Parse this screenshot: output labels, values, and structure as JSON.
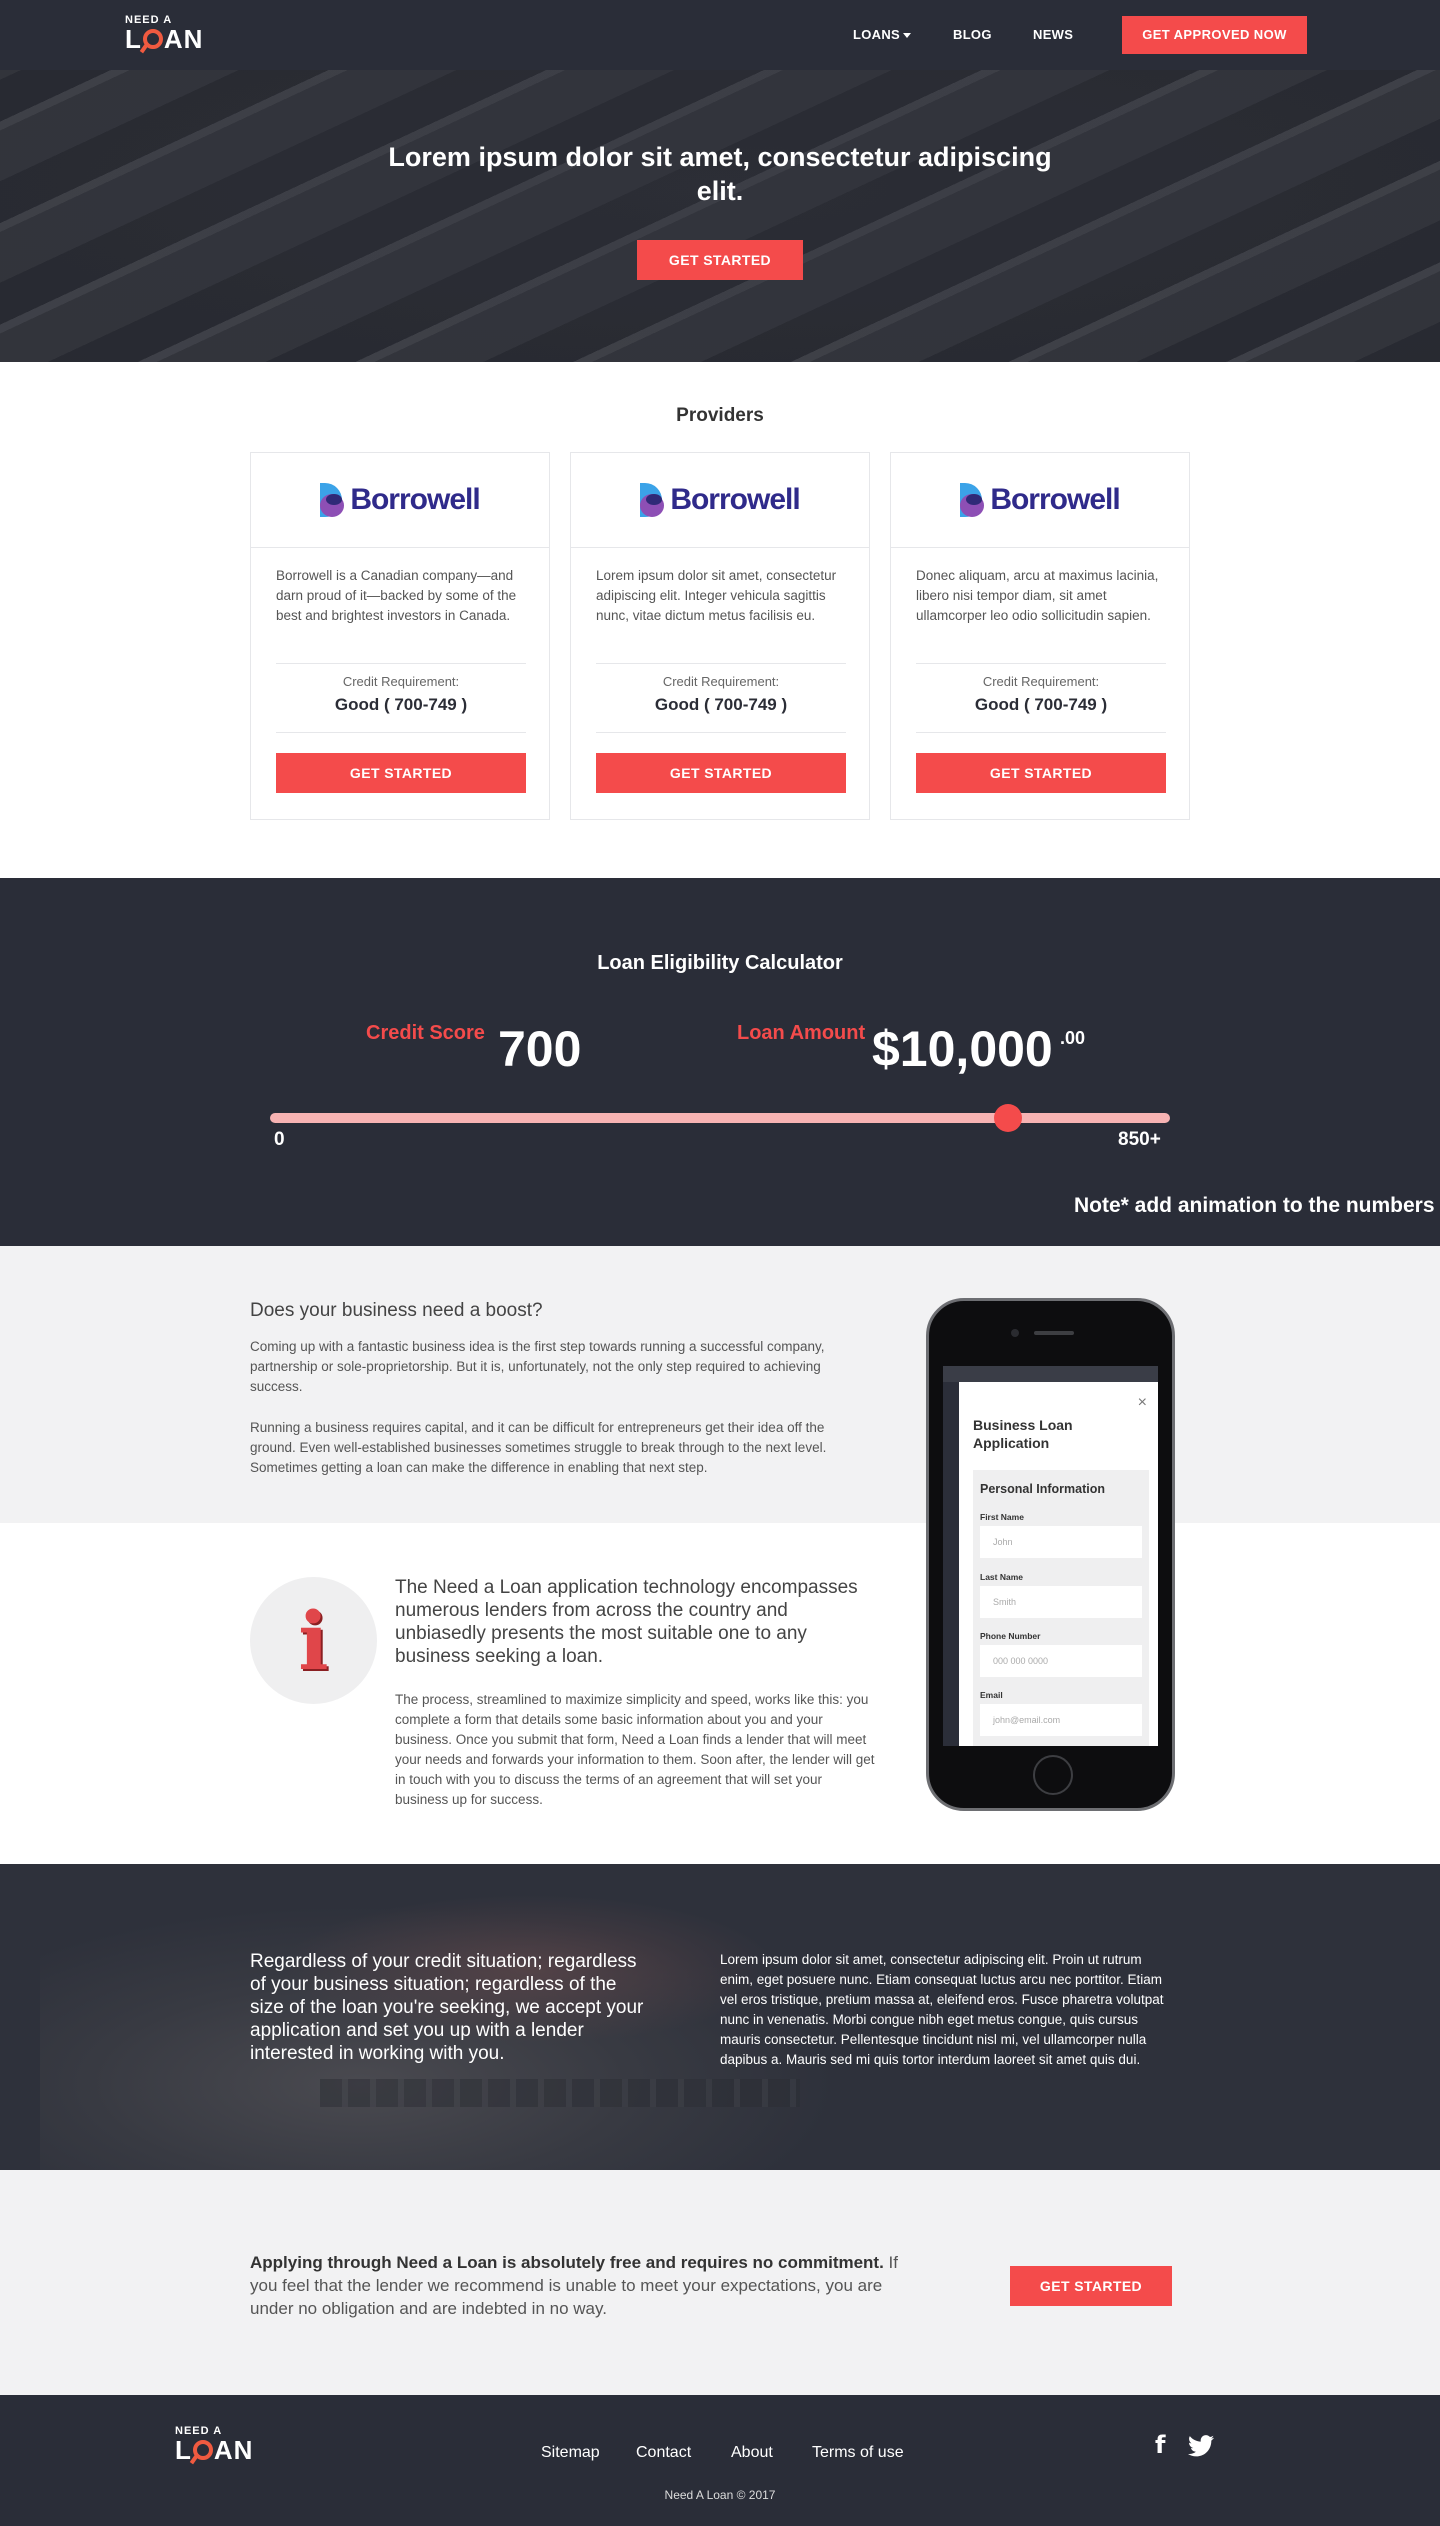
{
  "header": {
    "logo_small": "NEED A",
    "logo_l": "L",
    "logo_an": "AN",
    "nav": {
      "loans": "LOANS",
      "blog": "BLOG",
      "news": "NEWS"
    },
    "cta": "GET APPROVED NOW"
  },
  "hero": {
    "title": "Lorem ipsum dolor sit amet, consectetur adipiscing elit.",
    "cta": "GET STARTED"
  },
  "providers": {
    "title": "Providers",
    "cards": [
      {
        "brand": "Borrowell",
        "description": "Borrowell is a Canadian company—and darn proud of it—backed by some of the best and brightest investors in Canada.",
        "req_label": "Credit Requirement:",
        "req_value": "Good ( 700-749 )",
        "cta": "GET STARTED"
      },
      {
        "brand": "Borrowell",
        "description": "Lorem ipsum dolor sit amet, consectetur adipiscing elit. Integer vehicula sagittis nunc, vitae dictum metus facilisis eu.",
        "req_label": "Credit Requirement:",
        "req_value": "Good ( 700-749 )",
        "cta": "GET STARTED"
      },
      {
        "brand": "Borrowell",
        "description": "Donec aliquam, arcu at maximus lacinia, libero nisi tempor diam, sit amet ullamcorper leo odio sollicitudin sapien.",
        "req_label": "Credit Requirement:",
        "req_value": "Good ( 700-749 )",
        "cta": "GET STARTED"
      }
    ]
  },
  "calculator": {
    "title": "Loan Eligibility Calculator",
    "credit_label": "Credit Score",
    "credit_value": "700",
    "loan_label": "Loan Amount",
    "loan_value": "$10,000",
    "loan_cents": ".00",
    "slider_min": "0",
    "slider_max": "850+",
    "slider_fraction": 0.82,
    "note": "Note* add animation to the numbers"
  },
  "boost": {
    "title": "Does your business need a boost?",
    "p1": "Coming up with a fantastic business idea is the first step towards running a successful company, partnership or sole-proprietorship. But it is, unfortunately, not the only step required to achieving success.",
    "p2": "Running a business requires capital, and it can be difficult for entrepreneurs get their idea off the ground. Even well-established businesses sometimes struggle to break through to the next level. Sometimes getting a loan can make the difference in enabling that next step."
  },
  "info": {
    "icon_glyph": "i",
    "title": "The Need a Loan application technology encompasses numerous lenders from across the country and unbiasedly presents the most suitable one to any business seeking a loan.",
    "body": "The process, streamlined to maximize simplicity and speed, works like this: you complete a form that details some basic information about you and your business. Once you submit that form, Need a Loan finds a lender that will meet your needs and forwards your information to them. Soon after, the lender will get in touch with you to discuss the terms of an agreement that will set your business up for success."
  },
  "phone_form": {
    "close": "×",
    "title": "Business Loan Application",
    "section": "Personal Information",
    "fields": [
      {
        "label": "First Name",
        "placeholder": "John"
      },
      {
        "label": "Last Name",
        "placeholder": "Smith"
      },
      {
        "label": "Phone Number",
        "placeholder": "000 000 0000"
      },
      {
        "label": "Email",
        "placeholder": "john@email.com"
      }
    ]
  },
  "quote": {
    "left": "Regardless of your credit situation; regardless of your business situation; regardless of the size of the loan you're seeking, we accept your application and set you up with a lender interested in working with you.",
    "right": "Lorem ipsum dolor sit amet, consectetur adipiscing elit. Proin ut rutrum enim, eget posuere nunc. Etiam consequat luctus arcu nec porttitor. Etiam vel eros tristique, pretium massa at, eleifend eros. Fusce pharetra volutpat nunc in venenatis. Morbi congue nibh eget metus congue, quis cursus mauris consectetur. Pellentesque tincidunt nisl mi, vel ullamcorper nulla dapibus a. Mauris sed mi quis tortor interdum laoreet sit amet quis dui."
  },
  "apply": {
    "bold": "Applying through Need a Loan is absolutely free and requires no commitment.",
    "rest": " If you feel that the lender we recommend is unable to meet your expectations, you are under no obligation and are indebted in no way.",
    "cta": "GET STARTED"
  },
  "footer": {
    "links": {
      "sitemap": "Sitemap",
      "contact": "Contact",
      "about": "About",
      "terms": "Terms of use"
    },
    "facebook_glyph": "f",
    "copyright": "Need A Loan © 2017"
  },
  "colors": {
    "accent": "#f44b4b",
    "dark": "#2a2d38",
    "logo_o": "#f05a40",
    "brand_blue": "#2f2a8a"
  },
  "icons": [
    "caret-down-icon",
    "borrowell-logo-icon",
    "info-icon",
    "close-icon",
    "facebook-icon",
    "twitter-icon"
  ]
}
